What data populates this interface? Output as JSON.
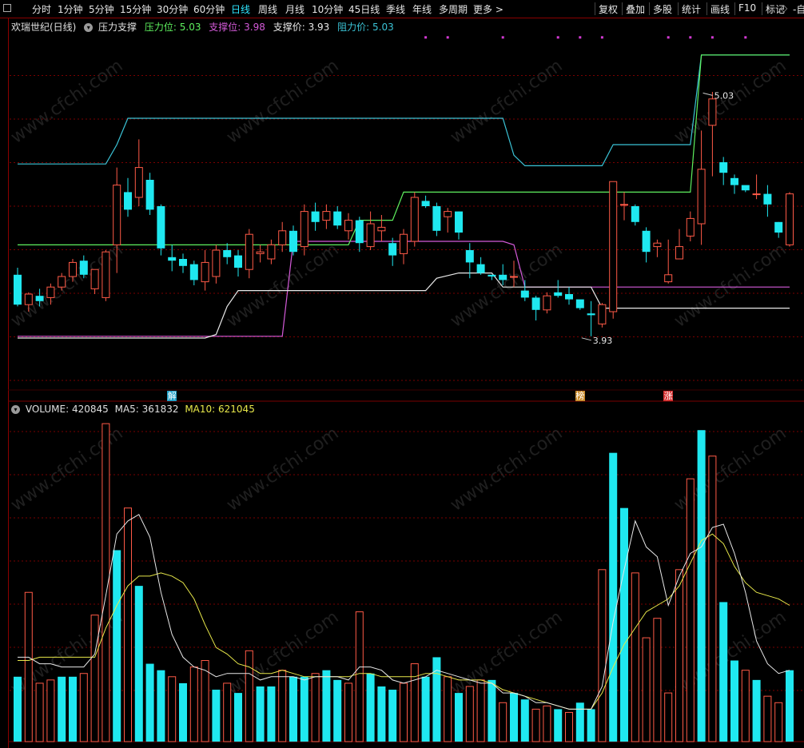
{
  "toolbar": {
    "periods": [
      "分时",
      "1分钟",
      "5分钟",
      "15分钟",
      "30分钟",
      "60分钟",
      "日线",
      "周线",
      "月线",
      "10分钟",
      "45日线",
      "季线",
      "年线",
      "多周期",
      "更多 >"
    ],
    "active_index": 6,
    "right_buttons": [
      "复权",
      "叠加",
      "多股",
      "统计",
      "画线",
      "F10",
      "标记"
    ],
    "diamond": "◇",
    "cut": "-自"
  },
  "header": {
    "stock": "欢瑞世纪(日线)",
    "indicator": "压力支撑",
    "pressure_label": "压力位:",
    "pressure_value": "5.03",
    "support_label": "支撑位:",
    "support_value": "3.98",
    "support_price_label": "支撑价:",
    "support_price_value": "3.93",
    "resist_price_label": "阻力价:",
    "resist_price_value": "5.03"
  },
  "price_annotations": {
    "high": "5.03",
    "low": "3.93"
  },
  "event_badges": [
    {
      "text": "解",
      "index": 14
    },
    {
      "text": "榜",
      "index": 51
    },
    {
      "text": "涨",
      "index": 59
    }
  ],
  "volume_header": {
    "label": "VOLUME:",
    "value": "420845",
    "ma5_label": "MA5:",
    "ma5_value": "361832",
    "ma10_label": "MA10:",
    "ma10_value": "621045"
  },
  "watermark": "www.cfchi.com",
  "colors": {
    "up": "#ff5a47",
    "down": "#1fe8f0",
    "resist_line": "#3bc3d6",
    "support_line": "#d45ad9",
    "green_line": "#5ef05e",
    "white_line": "#e8e8e8",
    "ma10": "#e8e84a",
    "grid": "#7a0000"
  },
  "chart_data": {
    "type": "candlestick",
    "ylim": [
      3.4,
      5.4
    ],
    "candles": [
      [
        4.01,
        3.84,
        4.05,
        3.83
      ],
      [
        3.84,
        3.9,
        3.91,
        3.8
      ],
      [
        3.89,
        3.86,
        3.93,
        3.83
      ],
      [
        3.88,
        3.94,
        3.96,
        3.84
      ],
      [
        3.94,
        4.0,
        4.02,
        3.92
      ],
      [
        4.0,
        4.08,
        4.1,
        3.97
      ],
      [
        4.09,
        4.01,
        4.12,
        3.99
      ],
      [
        3.93,
        4.04,
        4.04,
        3.9
      ],
      [
        3.88,
        4.14,
        4.15,
        3.86
      ],
      [
        4.18,
        4.52,
        4.62,
        4.02
      ],
      [
        4.48,
        4.38,
        4.56,
        4.34
      ],
      [
        4.45,
        4.62,
        4.78,
        4.4
      ],
      [
        4.55,
        4.38,
        4.59,
        4.35
      ],
      [
        4.4,
        4.16,
        4.41,
        4.12
      ],
      [
        4.11,
        4.09,
        4.18,
        4.03
      ],
      [
        4.1,
        4.06,
        4.13,
        4.02
      ],
      [
        4.07,
        3.98,
        4.09,
        3.95
      ],
      [
        3.97,
        4.08,
        4.15,
        3.92
      ],
      [
        4.0,
        4.15,
        4.18,
        3.96
      ],
      [
        4.15,
        4.11,
        4.19,
        4.07
      ],
      [
        4.12,
        4.05,
        4.15,
        4.0
      ],
      [
        4.04,
        4.24,
        4.27,
        3.99
      ],
      [
        4.13,
        4.14,
        4.18,
        4.08
      ],
      [
        4.1,
        4.18,
        4.21,
        4.07
      ],
      [
        4.18,
        4.26,
        4.31,
        4.14
      ],
      [
        4.26,
        4.14,
        4.29,
        4.12
      ],
      [
        4.17,
        4.37,
        4.41,
        4.12
      ],
      [
        4.37,
        4.31,
        4.42,
        4.26
      ],
      [
        4.32,
        4.37,
        4.41,
        4.27
      ],
      [
        4.37,
        4.29,
        4.4,
        4.27
      ],
      [
        4.26,
        4.32,
        4.36,
        4.21
      ],
      [
        4.32,
        4.19,
        4.34,
        4.14
      ],
      [
        4.17,
        4.3,
        4.37,
        4.15
      ],
      [
        4.26,
        4.28,
        4.35,
        4.2
      ],
      [
        4.19,
        4.12,
        4.22,
        4.06
      ],
      [
        4.13,
        4.24,
        4.27,
        4.07
      ],
      [
        4.2,
        4.45,
        4.48,
        4.17
      ],
      [
        4.43,
        4.4,
        4.46,
        4.39
      ],
      [
        4.4,
        4.26,
        4.42,
        4.23
      ],
      [
        4.34,
        4.37,
        4.39,
        4.25
      ],
      [
        4.37,
        4.25,
        4.37,
        4.21
      ],
      [
        4.15,
        4.08,
        4.19,
        3.99
      ],
      [
        4.07,
        4.02,
        4.11,
        4.01
      ],
      [
        4.01,
        4.0,
        4.01,
        3.98
      ],
      [
        4.01,
        3.98,
        4.07,
        3.95
      ],
      [
        4.0,
        4.0,
        4.09,
        3.94
      ],
      [
        3.92,
        3.88,
        3.98,
        3.86
      ],
      [
        3.88,
        3.81,
        3.89,
        3.75
      ],
      [
        3.81,
        3.89,
        3.91,
        3.79
      ],
      [
        3.91,
        3.89,
        3.98,
        3.88
      ],
      [
        3.9,
        3.87,
        3.94,
        3.84
      ],
      [
        3.87,
        3.82,
        3.84,
        3.81
      ],
      [
        3.79,
        3.78,
        3.86,
        3.66
      ],
      [
        3.73,
        3.84,
        3.85,
        3.71
      ],
      [
        3.8,
        4.54,
        4.54,
        3.76
      ],
      [
        4.41,
        4.41,
        4.48,
        4.32
      ],
      [
        4.4,
        4.31,
        4.41,
        4.29
      ],
      [
        4.26,
        4.14,
        4.28,
        4.08
      ],
      [
        4.17,
        4.19,
        4.21,
        4.11
      ],
      [
        3.97,
        4.01,
        4.21,
        3.96
      ],
      [
        4.1,
        4.17,
        4.27,
        4.13
      ],
      [
        4.23,
        4.33,
        4.37,
        4.2
      ],
      [
        4.3,
        4.61,
        4.83,
        4.18
      ],
      [
        4.86,
        5.01,
        5.05,
        4.57
      ],
      [
        4.65,
        4.59,
        4.68,
        4.52
      ],
      [
        4.56,
        4.52,
        4.58,
        4.47
      ],
      [
        4.52,
        4.49,
        4.5,
        4.48
      ],
      [
        4.47,
        4.47,
        4.58,
        4.44
      ],
      [
        4.47,
        4.41,
        4.52,
        4.34
      ],
      [
        4.31,
        4.25,
        4.31,
        4.22
      ],
      [
        4.18,
        4.47,
        4.48,
        4.17
      ]
    ],
    "volumes": [
      [
        0.2,
        -1
      ],
      [
        0.46,
        1
      ],
      [
        0.18,
        1
      ],
      [
        0.19,
        1
      ],
      [
        0.2,
        -1
      ],
      [
        0.2,
        -1
      ],
      [
        0.21,
        1
      ],
      [
        0.39,
        1
      ],
      [
        0.98,
        1
      ],
      [
        0.59,
        -1
      ],
      [
        0.72,
        1
      ],
      [
        0.48,
        -1
      ],
      [
        0.24,
        -1
      ],
      [
        0.22,
        -1
      ],
      [
        0.2,
        1
      ],
      [
        0.18,
        -1
      ],
      [
        0.23,
        1
      ],
      [
        0.25,
        1
      ],
      [
        0.16,
        -1
      ],
      [
        0.18,
        1
      ],
      [
        0.15,
        -1
      ],
      [
        0.28,
        1
      ],
      [
        0.17,
        -1
      ],
      [
        0.17,
        -1
      ],
      [
        0.22,
        1
      ],
      [
        0.2,
        -1
      ],
      [
        0.2,
        -1
      ],
      [
        0.21,
        1
      ],
      [
        0.22,
        -1
      ],
      [
        0.19,
        -1
      ],
      [
        0.18,
        1
      ],
      [
        0.4,
        1
      ],
      [
        0.21,
        -1
      ],
      [
        0.17,
        -1
      ],
      [
        0.16,
        -1
      ],
      [
        0.18,
        1
      ],
      [
        0.24,
        1
      ],
      [
        0.2,
        -1
      ],
      [
        0.26,
        -1
      ],
      [
        0.2,
        1
      ],
      [
        0.15,
        -1
      ],
      [
        0.17,
        1
      ],
      [
        0.19,
        1
      ],
      [
        0.19,
        -1
      ],
      [
        0.12,
        1
      ],
      [
        0.15,
        -1
      ],
      [
        0.13,
        -1
      ],
      [
        0.1,
        1
      ],
      [
        0.11,
        1
      ],
      [
        0.1,
        -1
      ],
      [
        0.09,
        1
      ],
      [
        0.12,
        -1
      ],
      [
        0.1,
        -1
      ],
      [
        0.53,
        1
      ],
      [
        0.89,
        -1
      ],
      [
        0.72,
        -1
      ],
      [
        0.52,
        1
      ],
      [
        0.32,
        1
      ],
      [
        0.38,
        1
      ],
      [
        0.15,
        1
      ],
      [
        0.53,
        1
      ],
      [
        0.81,
        1
      ],
      [
        0.96,
        -1
      ],
      [
        0.88,
        1
      ],
      [
        0.43,
        -1
      ],
      [
        0.25,
        -1
      ],
      [
        0.22,
        1
      ],
      [
        0.19,
        -1
      ],
      [
        0.14,
        1
      ],
      [
        0.12,
        1
      ],
      [
        0.22,
        -1
      ]
    ],
    "ma5": [
      0.26,
      0.26,
      0.24,
      0.24,
      0.23,
      0.23,
      0.23,
      0.27,
      0.45,
      0.64,
      0.68,
      0.7,
      0.63,
      0.46,
      0.33,
      0.26,
      0.23,
      0.22,
      0.2,
      0.21,
      0.21,
      0.21,
      0.19,
      0.2,
      0.2,
      0.2,
      0.19,
      0.2,
      0.2,
      0.2,
      0.19,
      0.23,
      0.23,
      0.22,
      0.19,
      0.18,
      0.19,
      0.2,
      0.22,
      0.21,
      0.2,
      0.19,
      0.18,
      0.18,
      0.15,
      0.15,
      0.14,
      0.12,
      0.12,
      0.11,
      0.1,
      0.1,
      0.1,
      0.17,
      0.37,
      0.53,
      0.68,
      0.6,
      0.57,
      0.42,
      0.51,
      0.58,
      0.6,
      0.66,
      0.67,
      0.58,
      0.46,
      0.31,
      0.24,
      0.21,
      0.22
    ],
    "ma10": [
      0.25,
      0.25,
      0.26,
      0.26,
      0.26,
      0.26,
      0.26,
      0.26,
      0.35,
      0.42,
      0.48,
      0.51,
      0.51,
      0.52,
      0.51,
      0.49,
      0.44,
      0.36,
      0.29,
      0.27,
      0.24,
      0.23,
      0.21,
      0.21,
      0.22,
      0.21,
      0.2,
      0.2,
      0.2,
      0.2,
      0.2,
      0.21,
      0.21,
      0.2,
      0.2,
      0.2,
      0.2,
      0.21,
      0.21,
      0.2,
      0.19,
      0.19,
      0.19,
      0.18,
      0.16,
      0.15,
      0.14,
      0.13,
      0.12,
      0.11,
      0.1,
      0.1,
      0.1,
      0.15,
      0.23,
      0.3,
      0.35,
      0.4,
      0.42,
      0.44,
      0.48,
      0.55,
      0.62,
      0.64,
      0.61,
      0.54,
      0.49,
      0.46,
      0.45,
      0.44,
      0.42
    ],
    "resist_line": [
      [
        0,
        4.64
      ],
      [
        8,
        4.64
      ],
      [
        9,
        4.75
      ],
      [
        10,
        4.9
      ],
      [
        44,
        4.9
      ],
      [
        45,
        4.69
      ],
      [
        46,
        4.63
      ],
      [
        52,
        4.63
      ],
      [
        53,
        4.63
      ],
      [
        54,
        4.75
      ],
      [
        61,
        4.75
      ],
      [
        62,
        5.26
      ],
      [
        70,
        5.26
      ]
    ],
    "support_line": [
      [
        0,
        3.66
      ],
      [
        24,
        3.66
      ],
      [
        25,
        4.2
      ],
      [
        44,
        4.2
      ],
      [
        45,
        4.18
      ],
      [
        46,
        3.94
      ],
      [
        70,
        3.94
      ]
    ],
    "green_line": [
      [
        0,
        4.18
      ],
      [
        30,
        4.18
      ],
      [
        31,
        4.32
      ],
      [
        34,
        4.32
      ],
      [
        35,
        4.48
      ],
      [
        36,
        4.48
      ],
      [
        37,
        4.48
      ],
      [
        61,
        4.48
      ],
      [
        62,
        5.26
      ],
      [
        70,
        5.26
      ]
    ],
    "white_line": [
      [
        0,
        3.65
      ],
      [
        17,
        3.65
      ],
      [
        18,
        3.67
      ],
      [
        19,
        3.83
      ],
      [
        20,
        3.92
      ],
      [
        37,
        3.92
      ],
      [
        38,
        3.99
      ],
      [
        40,
        4.02
      ],
      [
        43,
        4.02
      ],
      [
        44,
        3.94
      ],
      [
        45,
        3.94
      ],
      [
        46,
        3.94
      ],
      [
        52,
        3.94
      ],
      [
        53,
        3.82
      ],
      [
        70,
        3.82
      ]
    ],
    "markers": [
      [
        37,
        5.36
      ],
      [
        39,
        5.36
      ],
      [
        44,
        5.36
      ],
      [
        49,
        5.36
      ],
      [
        51,
        5.36
      ],
      [
        53,
        5.36
      ],
      [
        59,
        5.36
      ],
      [
        61,
        5.36
      ],
      [
        63,
        5.36
      ],
      [
        66,
        5.36
      ]
    ]
  }
}
